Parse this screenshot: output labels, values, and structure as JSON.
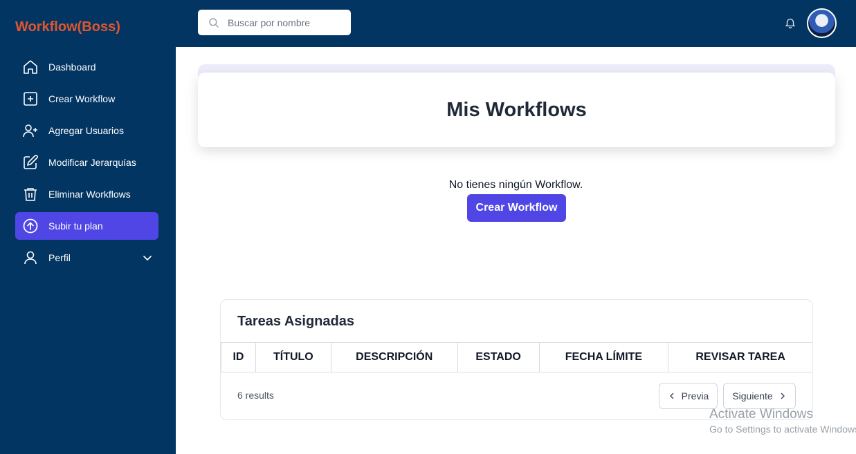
{
  "brand": "Workflow(Boss)",
  "search": {
    "placeholder": "Buscar por nombre"
  },
  "sidebar": {
    "items": [
      {
        "label": "Dashboard",
        "icon": "home-icon"
      },
      {
        "label": "Crear Workflow",
        "icon": "plus-square-icon"
      },
      {
        "label": "Agregar Usuarios",
        "icon": "user-plus-icon"
      },
      {
        "label": "Modificar Jerarquías",
        "icon": "edit-icon"
      },
      {
        "label": "Eliminar Workflows",
        "icon": "trash-icon"
      },
      {
        "label": "Subir tu plan",
        "icon": "upload-circle-icon",
        "active": true
      },
      {
        "label": "Perfil",
        "icon": "user-icon",
        "expandable": true
      }
    ]
  },
  "main": {
    "title": "Mis Workflows",
    "empty_message": "No tienes ningún Workflow.",
    "create_button": "Crear Workflow"
  },
  "tasks": {
    "title": "Tareas Asignadas",
    "columns": [
      "ID",
      "TÍTULO",
      "DESCRIPCIÓN",
      "ESTADO",
      "FECHA LÍMITE",
      "REVISAR TAREA"
    ],
    "results": "6 results",
    "prev_label": "Previa",
    "next_label": "Siguiente"
  },
  "watermark": {
    "line1": "Activate Windows",
    "line2": "Go to Settings to activate Windows."
  },
  "colors": {
    "navy": "#023562",
    "accent": "#4f46e5",
    "brand": "#e2552e"
  }
}
